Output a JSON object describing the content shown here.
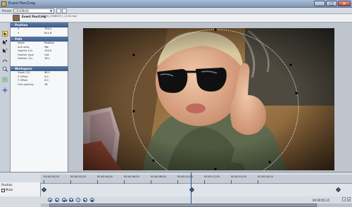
{
  "window": {
    "title": "Event Pan/Crop",
    "controls": [
      "_",
      "□",
      "✕"
    ]
  },
  "preset": {
    "label": "Preset:",
    "value": "(Untitled)"
  },
  "media": {
    "title": "Event Pan/Crop",
    "file": "DSCN_20080517_1123.mov",
    "sub": ""
  },
  "panel": {
    "sections": [
      {
        "name": "Position",
        "rows": [
          {
            "key": "X",
            "value": "750.2"
          },
          {
            "key": "Y",
            "value": "811.6"
          }
        ]
      },
      {
        "name": "Path",
        "rows": [
          {
            "key": "Mode",
            "value": "Positive"
          },
          {
            "key": "Anti alias",
            "value": "Yes"
          },
          {
            "key": "Opacity (%)",
            "value": "100.0"
          },
          {
            "key": "Feather type",
            "value": "Out"
          },
          {
            "key": "Feather (%)",
            "value": "16.1"
          }
        ]
      },
      {
        "name": "Workspace",
        "rows": [
          {
            "key": "Zoom (%)",
            "value": "46.1"
          },
          {
            "key": "X Offset",
            "value": "0.0"
          },
          {
            "key": "Y Offset",
            "value": "0.0"
          },
          {
            "key": "Grid spacing",
            "value": "16"
          }
        ]
      }
    ]
  },
  "timeline": {
    "tracks": [
      {
        "label": "Position"
      },
      {
        "label": "Mask"
      }
    ],
    "ticks": [
      "00:00:00,00",
      "00:00:02,00",
      "00:00:04,00",
      "00:00:06,00",
      "00:00:08,00",
      "00:00:10,00",
      "00:00:12,00",
      "00:00:14,00",
      "00:00:16,00"
    ],
    "time": "00:00:05,15",
    "transport": [
      "◀",
      "▶",
      "◀◀",
      "▶▶",
      "|◀",
      "▶|",
      "●"
    ]
  },
  "colors": {
    "titlebar": "#8fa5c4",
    "section_header": "#4a6794",
    "mask_path": "#ffffff"
  }
}
